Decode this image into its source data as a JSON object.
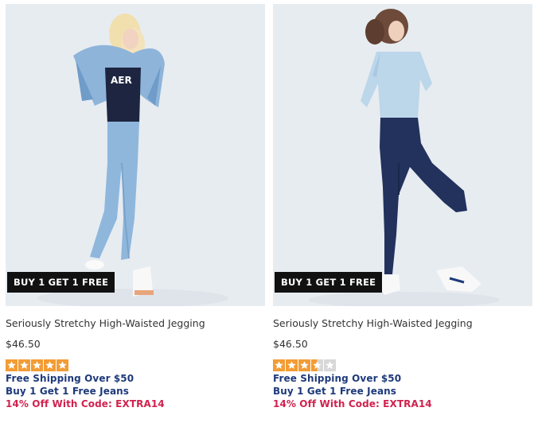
{
  "products": [
    {
      "badge": "BUY 1 GET 1 FREE",
      "title": "Seriously Stretchy High-Waisted Jegging",
      "price": "$46.50",
      "rating": 5,
      "promos": [
        "Free Shipping Over $50",
        "Buy 1 Get 1 Free Jeans",
        "14% Off With Code: EXTRA14"
      ],
      "image_icon": "model-light-wash-jegging-photo"
    },
    {
      "badge": "BUY 1 GET 1 FREE",
      "title": "Seriously Stretchy High-Waisted Jegging",
      "price": "$46.50",
      "rating": 3.5,
      "promos": [
        "Free Shipping Over $50",
        "Buy 1 Get 1 Free Jeans",
        "14% Off With Code: EXTRA14"
      ],
      "image_icon": "model-dark-wash-jegging-photo"
    }
  ],
  "colors": {
    "star_filled": "#f39c34",
    "star_empty": "#d8d8d8",
    "promo_blue": "#1e3a7a",
    "promo_red": "#d0224e",
    "badge_bg": "#111111"
  }
}
